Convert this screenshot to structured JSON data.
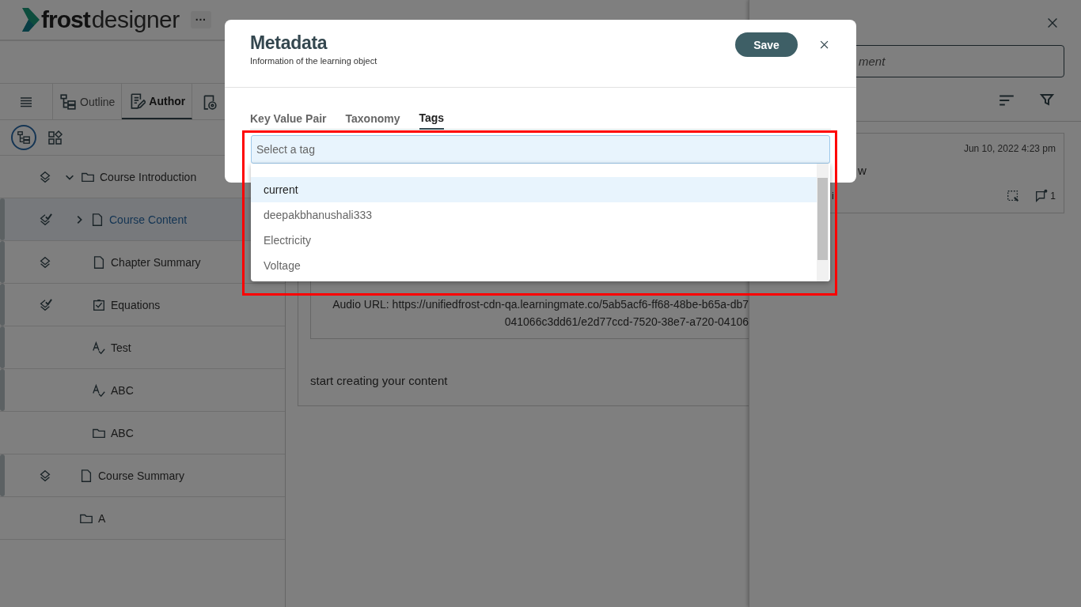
{
  "app": {
    "logo_bold": "frost",
    "logo_light": "designer",
    "more_button": "···"
  },
  "view_tabs": [
    {
      "label": "Outline",
      "kind": "outline",
      "selected": false
    },
    {
      "label": "Author",
      "kind": "author",
      "selected": true
    }
  ],
  "tree": [
    {
      "label": "Course Introduction",
      "kind": "folder",
      "layers": true,
      "checked": false,
      "flagged": false,
      "selected": false,
      "expanded": true,
      "children": [
        {
          "label": "Course Content",
          "kind": "page",
          "layers": true,
          "checked": true,
          "flagged": true,
          "selected": true,
          "expanded": false
        },
        {
          "label": "Chapter Summary",
          "kind": "page",
          "layers": true,
          "checked": false,
          "flagged": true,
          "selected": false
        },
        {
          "label": "Equations",
          "kind": "checklist",
          "layers": true,
          "checked": true,
          "flagged": true,
          "selected": false
        },
        {
          "label": "Test",
          "kind": "spell",
          "layers": false,
          "flagged": true,
          "selected": false
        },
        {
          "label": "ABC",
          "kind": "spell",
          "layers": false,
          "flagged": true,
          "selected": false
        },
        {
          "label": "ABC",
          "kind": "folder",
          "layers": false,
          "flagged": false,
          "selected": false
        }
      ]
    },
    {
      "label": "Course Summary",
      "kind": "page",
      "layers": true,
      "checked": false,
      "flagged": true,
      "selected": false
    },
    {
      "label": "A",
      "kind": "folder",
      "layers": false,
      "flagged": false,
      "selected": false
    }
  ],
  "content": {
    "audio_lines": [
      "Audio URL: https://unifiedfrost-cdn-qa.learningmate.co/5ab5acf6-ff68-48be-b65a-db7",
      "041066c3dd61/e2d77ccd-7520-38e7-a720-04106"
    ],
    "prompt": "start creating your content"
  },
  "comments": {
    "field": {
      "value": "ment"
    },
    "card": {
      "date": "Jun 10, 2022 4:23 pm",
      "text": "w",
      "meta": "i",
      "reply_count": "1"
    }
  },
  "modal": {
    "title": "Metadata",
    "subtitle": "Information of the learning object",
    "save": "Save",
    "tabs": [
      {
        "label": "Key Value Pair",
        "selected": false
      },
      {
        "label": "Taxonomy",
        "selected": false
      },
      {
        "label": "Tags",
        "selected": true
      }
    ],
    "tag_field": {
      "placeholder": "Select a tag"
    },
    "options": [
      {
        "label": "current",
        "selected": true
      },
      {
        "label": "deepakbhanushali333",
        "selected": false
      },
      {
        "label": "Electricity",
        "selected": false
      },
      {
        "label": "Voltage",
        "selected": false
      }
    ]
  }
}
